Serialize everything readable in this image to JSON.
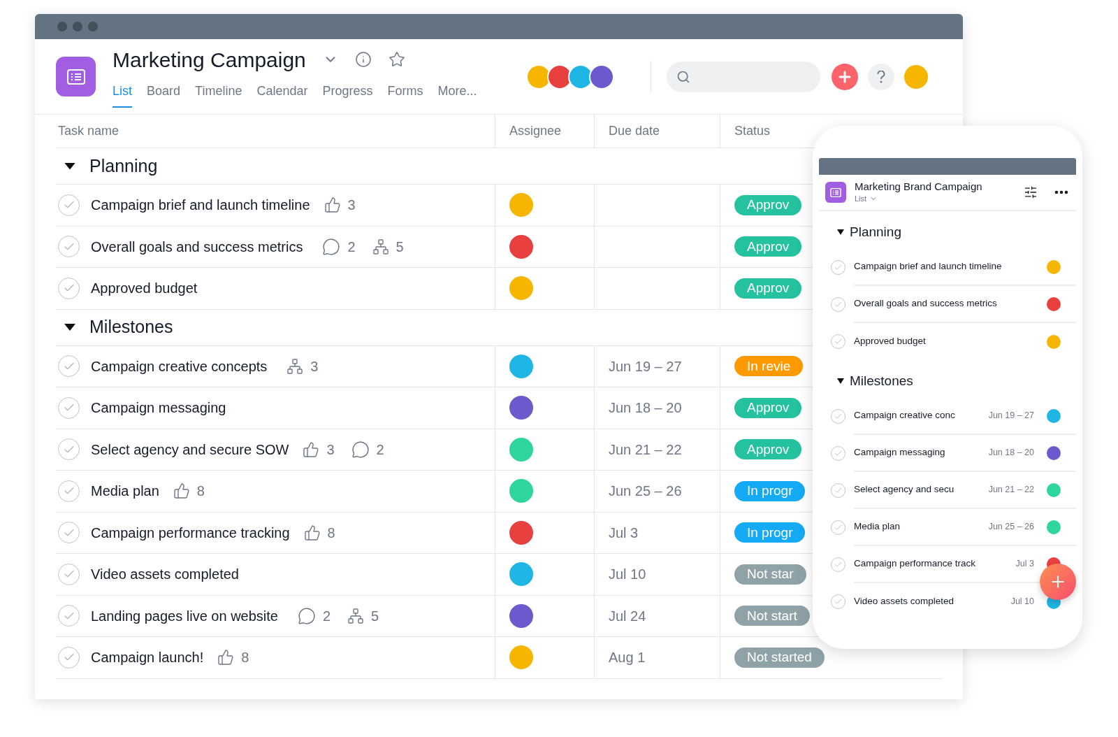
{
  "project": {
    "title": "Marketing Campaign"
  },
  "tabs": [
    {
      "label": "List",
      "selected": true
    },
    {
      "label": "Board",
      "selected": false
    },
    {
      "label": "Timeline",
      "selected": false
    },
    {
      "label": "Calendar",
      "selected": false
    },
    {
      "label": "Progress",
      "selected": false
    },
    {
      "label": "Forms",
      "selected": false
    },
    {
      "label": "More...",
      "selected": false
    }
  ],
  "members": [
    {
      "color": "#f6b500"
    },
    {
      "color": "#e8403f"
    },
    {
      "color": "#1fb6e6"
    },
    {
      "color": "#6a5acd"
    }
  ],
  "current_user": {
    "color": "#f6b500"
  },
  "table": {
    "columns": [
      "Task name",
      "Assignee",
      "Due date",
      "Status"
    ],
    "groups": [
      {
        "name": "Planning",
        "expanded": true,
        "tasks": [
          {
            "name": "Campaign brief and launch timeline",
            "likes": "3",
            "assignee": {
              "color": "#f6b500"
            },
            "status": {
              "label": "Approv",
              "kind": "approved"
            }
          },
          {
            "name": "Overall goals and success metrics",
            "comments": "2",
            "subtasks": "5",
            "assignee": {
              "color": "#e8403f"
            },
            "status": {
              "label": "Approv",
              "kind": "approved"
            }
          },
          {
            "name": "Approved budget",
            "assignee": {
              "color": "#f6b500"
            },
            "status": {
              "label": "Approv",
              "kind": "approved"
            }
          }
        ]
      },
      {
        "name": "Milestones",
        "expanded": true,
        "tasks": [
          {
            "name": "Campaign creative concepts",
            "subtasks": "3",
            "assignee": {
              "color": "#1fb6e6"
            },
            "due": "Jun 19 – 27",
            "status": {
              "label": "In revie",
              "kind": "review"
            }
          },
          {
            "name": "Campaign messaging",
            "assignee": {
              "color": "#6a5acd"
            },
            "due": "Jun 18 – 20",
            "status": {
              "label": "Approv",
              "kind": "approved"
            }
          },
          {
            "name": "Select agency and secure SOW",
            "likes": "3",
            "comments": "2",
            "assignee": {
              "color": "#2ed69c"
            },
            "due": "Jun 21 – 22",
            "status": {
              "label": "Approv",
              "kind": "approved"
            }
          },
          {
            "name": "Media plan",
            "likes": "8",
            "assignee": {
              "color": "#2ed69c"
            },
            "due": "Jun 25 – 26",
            "status": {
              "label": "In progr",
              "kind": "progress"
            }
          },
          {
            "name": "Campaign performance tracking",
            "likes": "8",
            "assignee": {
              "color": "#e8403f"
            },
            "due": "Jul 3",
            "status": {
              "label": "In progr",
              "kind": "progress"
            }
          },
          {
            "name": "Video assets completed",
            "assignee": {
              "color": "#1fb6e6"
            },
            "due": "Jul 10",
            "status": {
              "label": "Not star",
              "kind": "not_started"
            }
          },
          {
            "name": "Landing pages live on website",
            "comments": "2",
            "subtasks": "5",
            "assignee": {
              "color": "#6a5acd"
            },
            "due": "Jul 24",
            "status": {
              "label": "Not start",
              "kind": "not_started"
            }
          },
          {
            "name": "Campaign launch!",
            "likes": "8",
            "assignee": {
              "color": "#f6b500"
            },
            "due": "Aug 1",
            "status": {
              "label": "Not started",
              "kind": "not_started"
            }
          }
        ]
      }
    ]
  },
  "mobile": {
    "title": "Marketing Brand Campaign",
    "view": "List",
    "groups": [
      {
        "name": "Planning",
        "expanded": true,
        "tasks": [
          {
            "name": "Campaign brief and launch timeline",
            "assignee": {
              "color": "#f6b500"
            }
          },
          {
            "name": "Overall goals and success metrics",
            "assignee": {
              "color": "#e8403f"
            }
          },
          {
            "name": "Approved budget",
            "assignee": {
              "color": "#f6b500"
            }
          }
        ]
      },
      {
        "name": "Milestones",
        "expanded": true,
        "tasks": [
          {
            "name": "Campaign creative conc",
            "due": "Jun 19 – 27",
            "assignee": {
              "color": "#1fb6e6"
            }
          },
          {
            "name": "Campaign messaging",
            "due": "Jun 18 – 20",
            "assignee": {
              "color": "#6a5acd"
            }
          },
          {
            "name": "Select agency and secu",
            "due": "Jun 21 – 22",
            "assignee": {
              "color": "#2ed69c"
            }
          },
          {
            "name": "Media plan",
            "due": "Jun 25 – 26",
            "assignee": {
              "color": "#2ed69c"
            }
          },
          {
            "name": "Campaign performance track",
            "due": "Jul 3",
            "assignee": {
              "color": "#e8403f"
            }
          },
          {
            "name": "Video assets completed",
            "due": "Jul 10",
            "assignee": {
              "color": "#1fb6e6"
            }
          }
        ]
      }
    ]
  }
}
